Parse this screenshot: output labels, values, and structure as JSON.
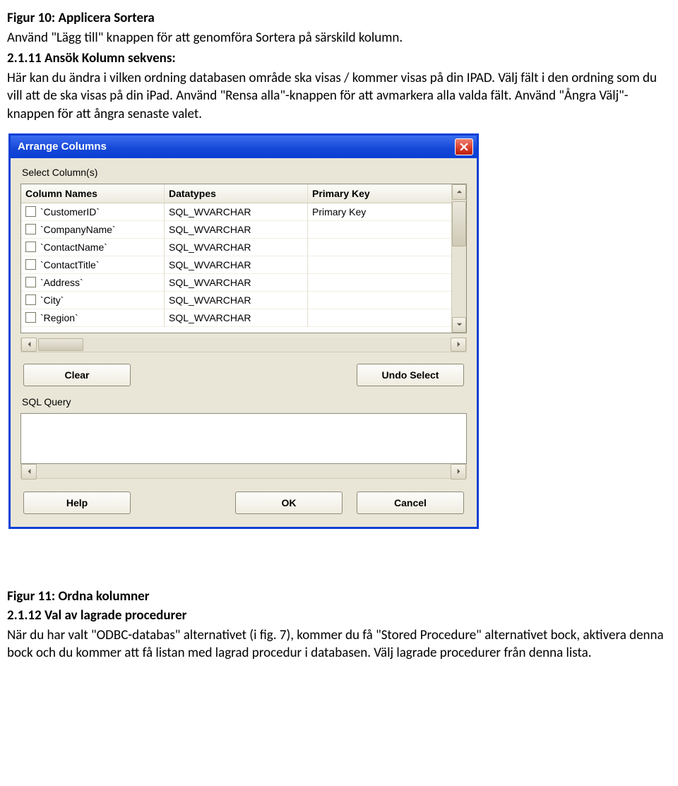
{
  "doc": {
    "fig10_title": "Figur 10: Applicera Sortera",
    "p1": "Använd \"Lägg till\" knappen för att genomföra Sortera på särskild kolumn.",
    "sec211": "2.1.11 Ansök Kolumn sekvens:",
    "p2": "Här kan du ändra i vilken ordning databasen område ska visas / kommer visas på din IPAD. Välj fält i den ordning som du vill att de ska visas på din iPad. Använd \"Rensa alla\"-knappen för att avmarkera alla valda fält. Använd \"Ångra Välj\"-knappen för att ångra senaste valet.",
    "fig11_title": "Figur 11: Ordna kolumner",
    "sec212": "2.1.12 Val av lagrade procedurer",
    "p3": "När du har valt \"ODBC-databas\" alternativet (i fig. 7), kommer du få \"Stored Procedure\" alternativet bock, aktivera denna bock och du kommer att få listan med lagrad procedur i databasen. Välj lagrade procedurer från denna lista."
  },
  "dialog": {
    "title": "Arrange Columns",
    "select_label": "Select Column(s)",
    "headers": {
      "c1": "Column Names",
      "c2": "Datatypes",
      "c3": "Primary Key"
    },
    "rows": [
      {
        "name": "`CustomerID`",
        "type": "SQL_WVARCHAR",
        "pk": "Primary Key"
      },
      {
        "name": "`CompanyName`",
        "type": "SQL_WVARCHAR",
        "pk": ""
      },
      {
        "name": "`ContactName`",
        "type": "SQL_WVARCHAR",
        "pk": ""
      },
      {
        "name": "`ContactTitle`",
        "type": "SQL_WVARCHAR",
        "pk": ""
      },
      {
        "name": "`Address`",
        "type": "SQL_WVARCHAR",
        "pk": ""
      },
      {
        "name": "`City`",
        "type": "SQL_WVARCHAR",
        "pk": ""
      },
      {
        "name": "`Region`",
        "type": "SQL_WVARCHAR",
        "pk": ""
      }
    ],
    "clear": "Clear",
    "undo": "Undo Select",
    "sql_label": "SQL Query",
    "help": "Help",
    "ok": "OK",
    "cancel": "Cancel"
  }
}
